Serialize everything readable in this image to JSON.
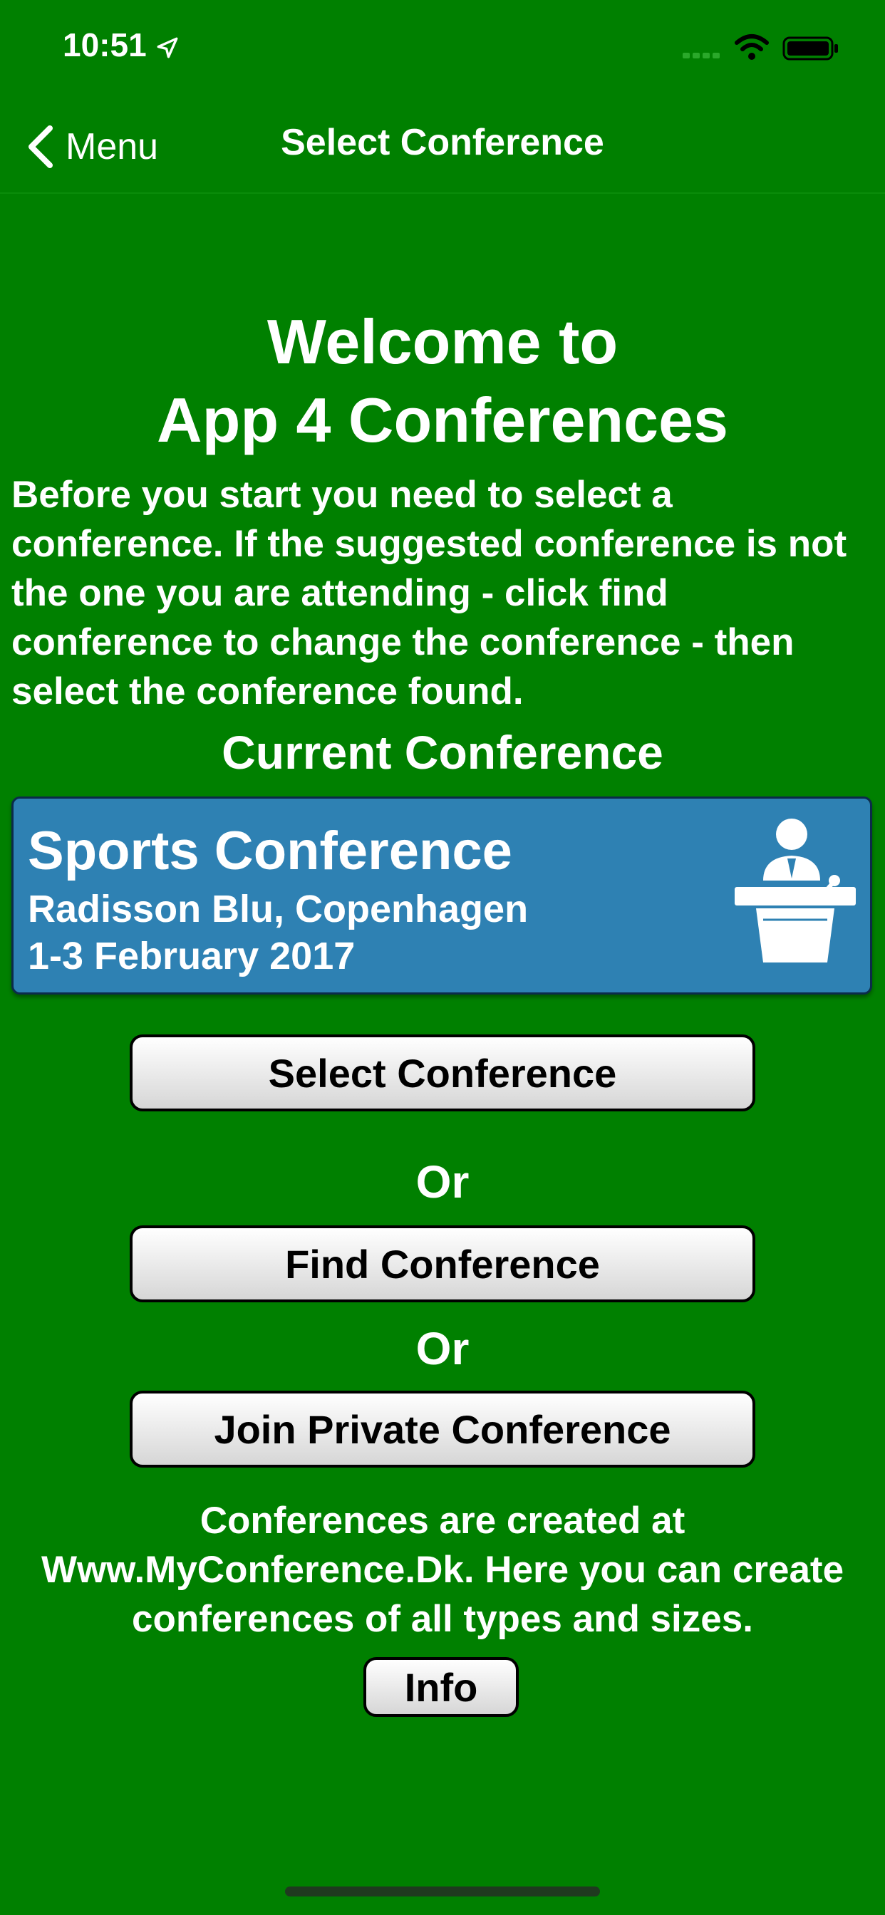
{
  "status_bar": {
    "time": "10:51",
    "icons": [
      "location-arrow-icon",
      "signal-icon",
      "wifi-icon",
      "battery-icon"
    ]
  },
  "nav": {
    "back_label": "Menu",
    "title": "Select Conference"
  },
  "welcome": {
    "line1": "Welcome to",
    "line2": "App 4 Conferences"
  },
  "intro_text": "Before you start you need to select a conference. If the suggested conference is not the one you are attending - click find conference to change the conference - then select the conference found.",
  "current_conference": {
    "heading": "Current Conference",
    "name": "Sports Conference",
    "venue": "Radisson Blu, Copenhagen",
    "dates": "1-3 February 2017",
    "icon": "speaker-podium-icon"
  },
  "actions": {
    "select_label": "Select Conference",
    "or_1": "Or",
    "find_label": "Find Conference",
    "or_2": "Or",
    "join_private_label": "Join Private Conference"
  },
  "footer": {
    "text": "Conferences are created at Www.MyConference.Dk. Here you can create conferences of all types and sizes.",
    "info_label": "Info"
  },
  "colors": {
    "background": "#008000",
    "card": "#2e81b3",
    "text": "#ffffff",
    "button_text": "#000000"
  }
}
